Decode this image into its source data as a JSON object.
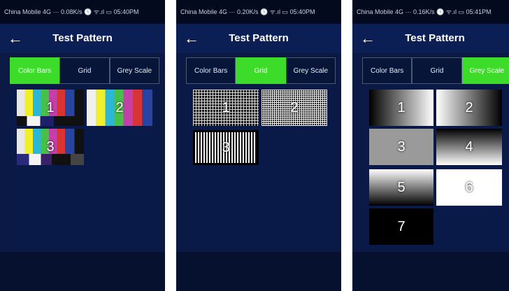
{
  "app": {
    "title": "Test Pattern"
  },
  "tabs": [
    "Color Bars",
    "Grid",
    "Grey Scale"
  ],
  "screens": [
    {
      "status": "China Mobile 4G ··· 0.08K/s 🕓 ᯤ.ıl ▭ 05:40PM",
      "thumbs": [
        "1",
        "2",
        "3"
      ]
    },
    {
      "status": "China Mobile 4G ··· 0.20K/s 🕓 ᯤ.ıl ▭ 05:40PM",
      "thumbs": [
        "1",
        "2",
        "3"
      ]
    },
    {
      "status": "China Mobile 4G ··· 0.16K/s 🕓 ᯤ.ıl ▭ 05:41PM",
      "thumbs": [
        "1",
        "2",
        "3",
        "4",
        "5",
        "6",
        "7"
      ]
    }
  ],
  "colors": {
    "accent": "#3ddc2a",
    "background": "#0b1a45"
  },
  "icons": {
    "back": "arrow-left-icon"
  }
}
